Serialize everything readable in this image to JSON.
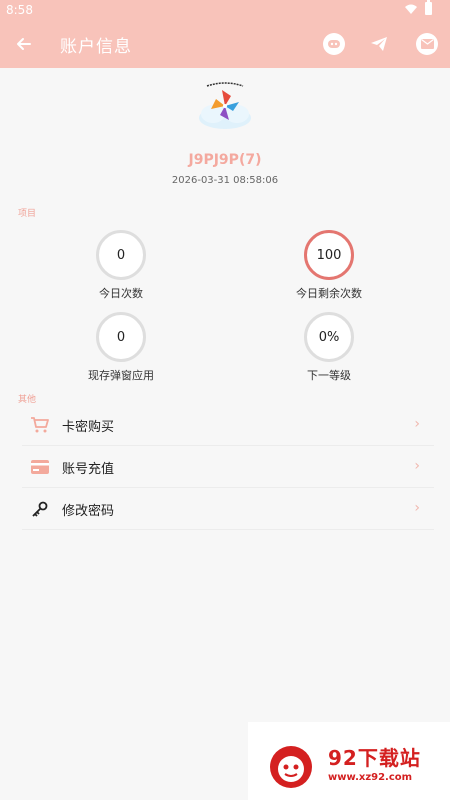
{
  "status_bar": {
    "time": "8:58"
  },
  "header": {
    "title": "账户信息"
  },
  "profile": {
    "username": "J9PJ9P(7)",
    "timestamp": "2026-03-31 08:58:06"
  },
  "sections": {
    "items_label": "项目",
    "other_label": "其他"
  },
  "stats": [
    {
      "value": "0",
      "label": "今日次数"
    },
    {
      "value": "100",
      "label": "今日剩余次数"
    },
    {
      "value": "0",
      "label": "现存弹窗应用"
    },
    {
      "value": "0%",
      "label": "下一等级"
    }
  ],
  "menu": [
    {
      "label": "卡密购买",
      "icon": "cart-icon"
    },
    {
      "label": "账号充值",
      "icon": "card-icon"
    },
    {
      "label": "修改密码",
      "icon": "key-icon"
    }
  ],
  "chevron": "›",
  "watermark": {
    "name": "92下载站",
    "url": "www.xz92.com"
  },
  "colors": {
    "accent": "#f8c3ba",
    "username": "#f4a99f",
    "ring_red": "#e47670",
    "watermark": "#d42020"
  }
}
